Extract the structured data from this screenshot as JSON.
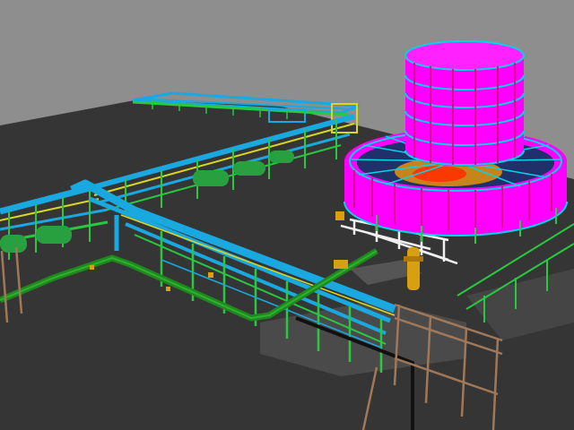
{
  "scene": {
    "view": "3d-plant-model",
    "background_color": "#8e8e8e",
    "ground_color": "#353535",
    "text": []
  },
  "colors": {
    "tank_shell": "#ff00ff",
    "tank_band": "#00d4e8",
    "tank_stiffener": "#d0005a",
    "pipe_cyan": "#1aa8e0",
    "pipe_green": "#1e8a1e",
    "steel_yellow": "#d8d820",
    "steel_green": "#28c840",
    "steel_tan": "#a07858",
    "support_white": "#f0f0f0",
    "equipment_gold": "#d8a010",
    "tank_inner_red": "#ff3000",
    "tank_inner_orange": "#ffa000"
  },
  "components": [
    "storage-tank",
    "tank-roof-structure",
    "main-pipe-rack",
    "overhead-conveyor",
    "green-pipeline",
    "steel-frame-structure",
    "pipe-supports",
    "vertical-vessel"
  ]
}
